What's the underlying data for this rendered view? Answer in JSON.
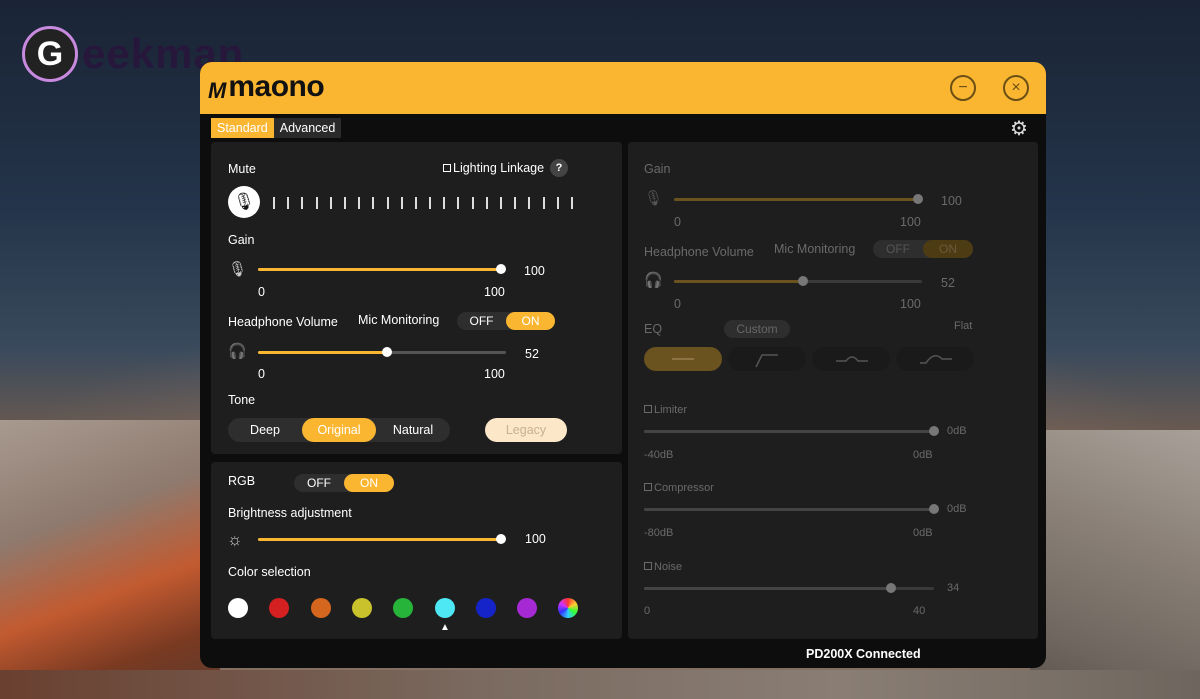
{
  "watermark": {
    "letter": "G",
    "text": "eekman"
  },
  "header": {
    "logo_mark": "M",
    "logo_text": "maono",
    "minimize_glyph": "−",
    "close_glyph": "×"
  },
  "tabs": [
    {
      "label": "Standard",
      "active": true
    },
    {
      "label": "Advanced",
      "active": false
    }
  ],
  "standard": {
    "mute_label": "Mute",
    "lighting_linkage_label": "Lighting Linkage",
    "help_glyph": "?",
    "gain": {
      "label": "Gain",
      "value": "100",
      "min": "0",
      "max": "100",
      "fraction": 1.0
    },
    "headphone": {
      "label": "Headphone Volume",
      "value": "52",
      "min": "0",
      "max": "100",
      "fraction": 0.52
    },
    "mic_monitoring": {
      "label": "Mic Monitoring",
      "off": "OFF",
      "on": "ON",
      "state": "ON"
    },
    "tone": {
      "label": "Tone",
      "options": [
        "Deep",
        "Original",
        "Natural"
      ],
      "selected": "Original",
      "legacy": "Legacy"
    },
    "rgb": {
      "label": "RGB",
      "off": "OFF",
      "on": "ON",
      "state": "ON"
    },
    "brightness": {
      "label": "Brightness adjustment",
      "value": "100",
      "fraction": 1.0
    },
    "color_selection": {
      "label": "Color selection",
      "colors": [
        "#ffffff",
        "#d42020",
        "#d4661e",
        "#c9c22c",
        "#27b43a",
        "#4de8f4",
        "#1424c8",
        "#a52ad4",
        "rainbow"
      ],
      "selected_index": 5
    }
  },
  "advanced": {
    "gain": {
      "label": "Gain",
      "value": "100",
      "min": "0",
      "max": "100",
      "fraction": 1.0
    },
    "headphone": {
      "label": "Headphone Volume",
      "value": "52",
      "min": "0",
      "max": "100",
      "fraction": 0.52
    },
    "mic_monitoring": {
      "label": "Mic Monitoring",
      "off": "OFF",
      "on": "ON",
      "state": "ON"
    },
    "eq": {
      "label": "EQ",
      "preset": "Custom",
      "mode": "Flat"
    },
    "limiter": {
      "label": "Limiter",
      "value": "0dB",
      "min": "-40dB",
      "max": "0dB",
      "fraction": 1.0
    },
    "compressor": {
      "label": "Compressor",
      "value": "0dB",
      "min": "-80dB",
      "max": "0dB",
      "fraction": 1.0
    },
    "noise": {
      "label": "Noise",
      "value": "34",
      "min": "0",
      "max": "40",
      "fraction": 0.85
    }
  },
  "status": {
    "text": "PD200X Connected"
  },
  "colors": {
    "accent": "#fbb631",
    "panel": "#1e1e1e",
    "background": "#0d0d0d"
  }
}
